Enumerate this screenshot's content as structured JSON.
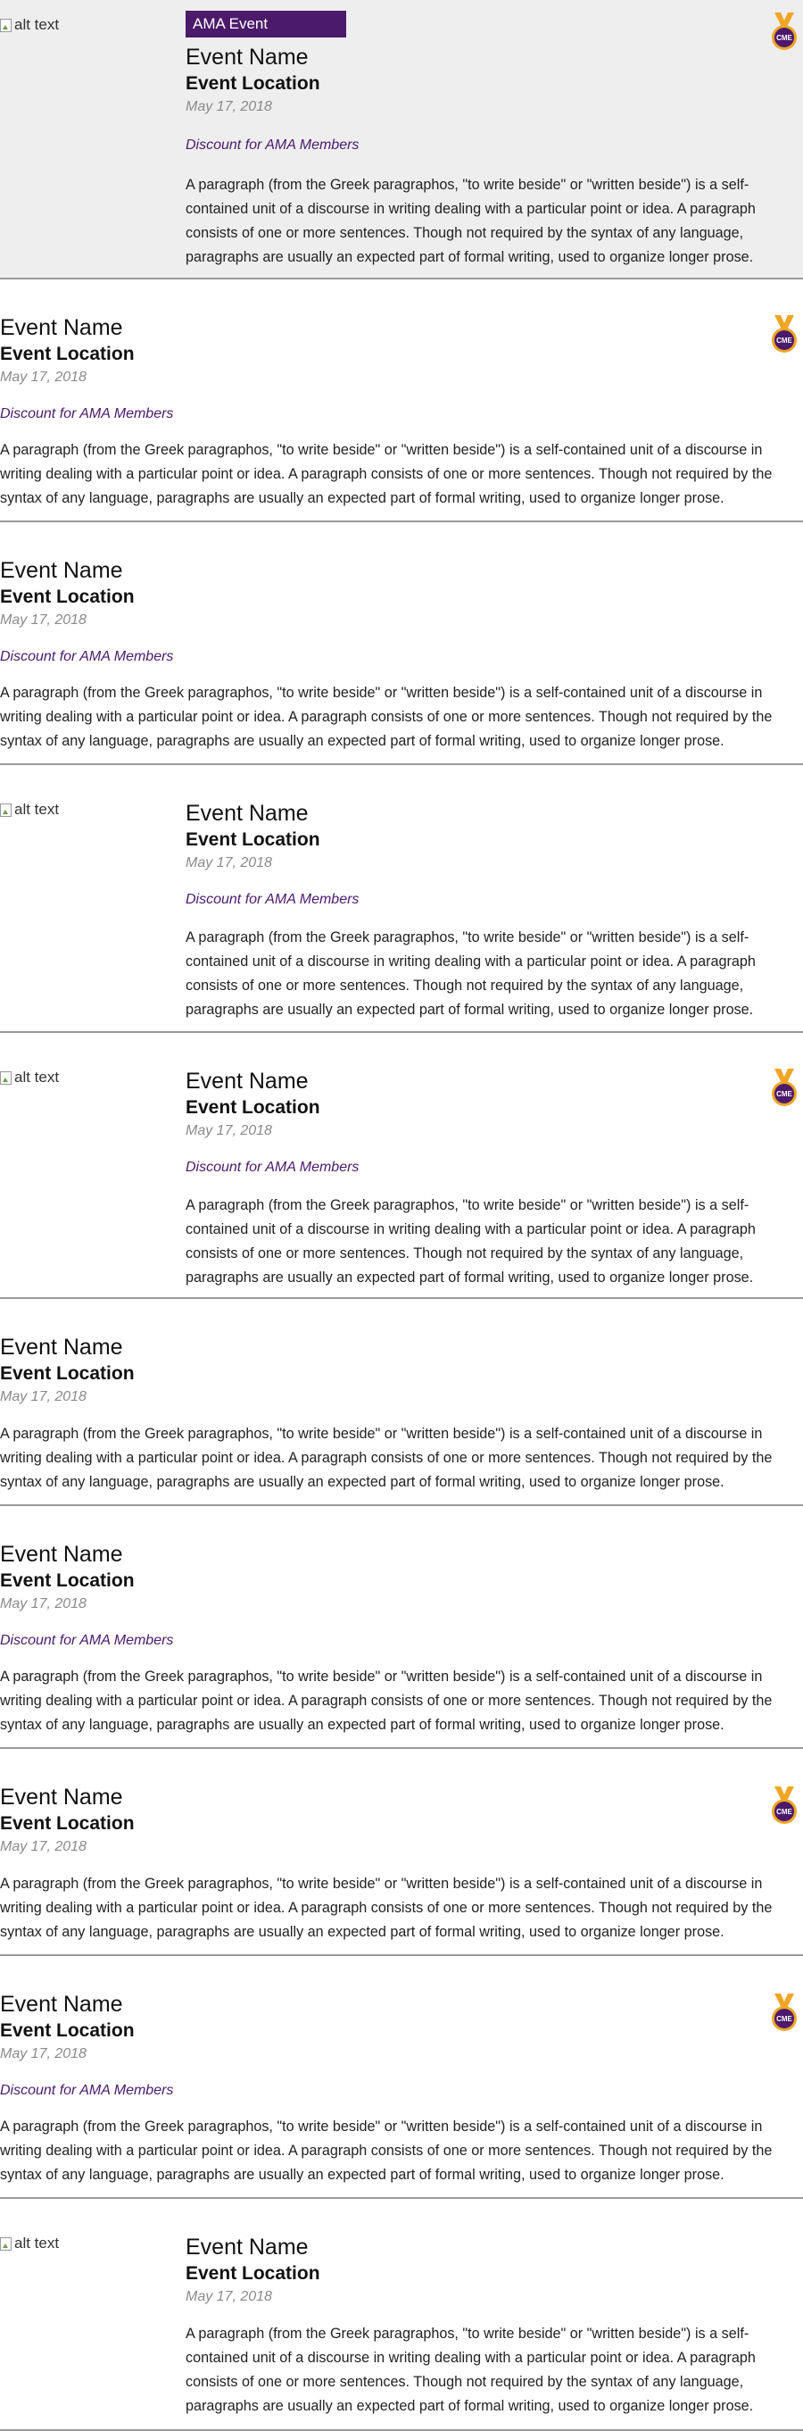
{
  "common": {
    "image_alt": "alt text",
    "badge": "AMA Event",
    "name": "Event Name",
    "location": "Event Location",
    "date": "May 17, 2018",
    "discount": "Discount for AMA Members",
    "description": "A paragraph (from the Greek paragraphos, \"to write beside\" or \"written beside\") is a self-contained unit of a discourse in writing dealing with a particular point or idea. A paragraph consists of one or more sentences. Though not required by the syntax of any language, paragraphs are usually an expected part of formal writing, used to organize longer prose.",
    "cme_label": "CME"
  },
  "colors": {
    "accent_purple": "#4b1a6b",
    "medal_gold": "#f0a526",
    "featured_background": "#eeeeee"
  },
  "icons": {
    "cme": "cme-medal-icon",
    "image": "broken-image-icon"
  }
}
